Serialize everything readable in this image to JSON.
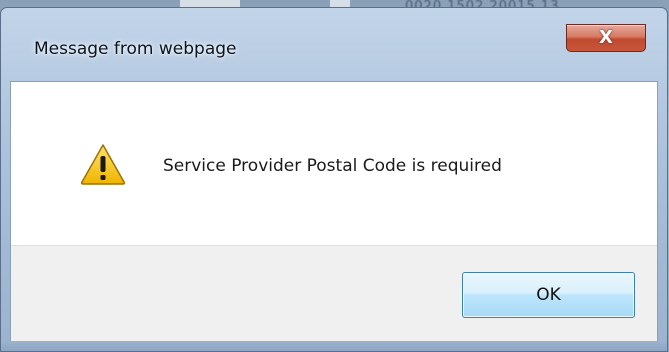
{
  "background": {
    "blurred_text": "0020 1502 20015 13"
  },
  "dialog": {
    "title": "Message from webpage",
    "close_icon": "close-icon",
    "close_symbol": "X",
    "message": "Service Provider Postal Code is required",
    "warning_icon": "warning-icon",
    "ok_label": "OK"
  },
  "colors": {
    "warning_fill": "#f5c400",
    "ok_border": "#3c7fb1",
    "close_red": "#c24a2f"
  }
}
